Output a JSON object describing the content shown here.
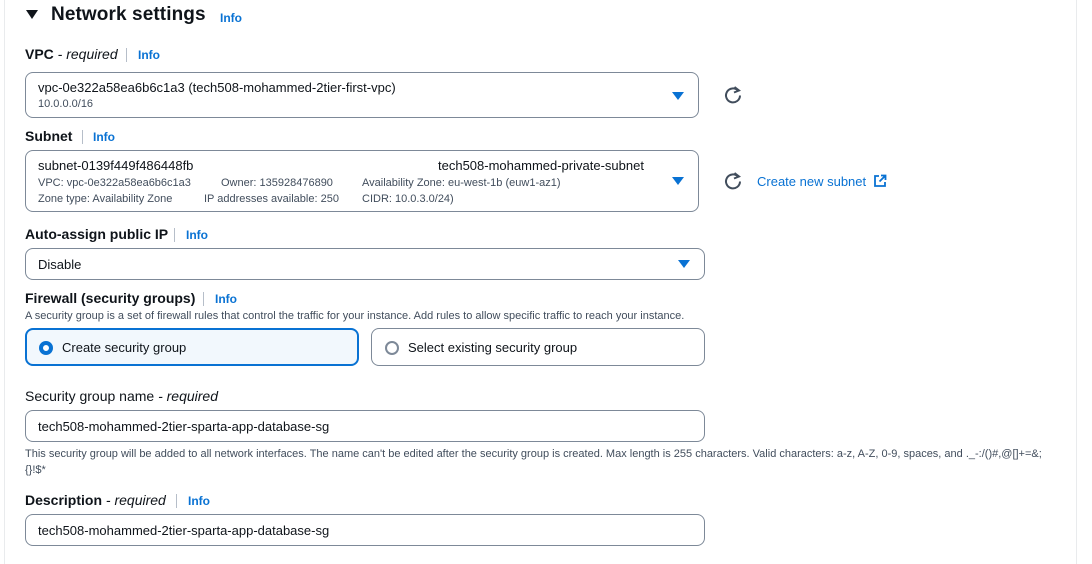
{
  "section": {
    "title": "Network settings",
    "info": "Info"
  },
  "vpc": {
    "label": "VPC",
    "required": " - required",
    "info": "Info",
    "value": "vpc-0e322a58ea6b6c1a3 (tech508-mohammed-2tier-first-vpc)",
    "cidr": "10.0.0.0/16"
  },
  "subnet": {
    "label": "Subnet",
    "info": "Info",
    "id": "subnet-0139f449f486448fb",
    "name": "tech508-mohammed-private-subnet",
    "vpc": "VPC: vpc-0e322a58ea6b6c1a3",
    "owner": "Owner: 135928476890",
    "az": "Availability Zone: eu-west-1b (euw1-az1)",
    "zone_type": "Zone type: Availability Zone",
    "ips": "IP addresses available: 250",
    "cidr": "CIDR: 10.0.3.0/24)",
    "create_link": "Create new subnet"
  },
  "public_ip": {
    "label": "Auto-assign public IP",
    "info": "Info",
    "value": "Disable"
  },
  "firewall": {
    "label": "Firewall (security groups)",
    "info": "Info",
    "description": "A security group is a set of firewall rules that control the traffic for your instance. Add rules to allow specific traffic to reach your instance.",
    "option_create": "Create security group",
    "option_existing": "Select existing security group",
    "selected": "create"
  },
  "sg_name": {
    "label": "Security group name",
    "required": " - required",
    "value": "tech508-mohammed-2tier-sparta-app-database-sg",
    "help": "This security group will be added to all network interfaces. The name can't be edited after the security group is created. Max length is 255 characters. Valid characters: a-z, A-Z, 0-9, spaces, and ._-:/()#,@[]+=&;{}!$*"
  },
  "description": {
    "label": "Description",
    "required": " - required",
    "info": "Info",
    "value": "tech508-mohammed-2tier-sparta-app-database-sg"
  },
  "colors": {
    "accent": "#0972d3",
    "border": "#7d8998",
    "text": "#0f141a"
  }
}
